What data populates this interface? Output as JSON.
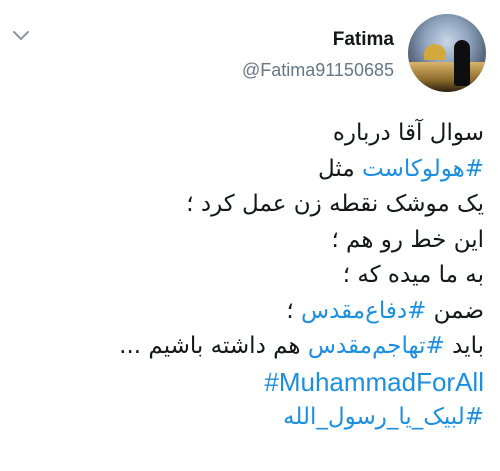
{
  "tweet": {
    "user": {
      "display_name": "Fatima",
      "handle": "@Fatima91150685"
    },
    "lines": [
      {
        "text": "سوال آقا درباره"
      },
      {
        "hashtag": "#هولوکاست",
        "after": " مثل"
      },
      {
        "text": "یک موشک نقطه زن عمل کرد ؛"
      },
      {
        "text": "این خط رو هم ؛"
      },
      {
        "text": " به ما میده که ؛"
      },
      {
        "before": "ضمن ",
        "hashtag": "#دفاع‌مقدس",
        "after": " ؛"
      },
      {
        "before": "باید ",
        "hashtag": "#تهاجم‌مقدس",
        "after": " هم داشته باشیم ..."
      }
    ],
    "hashtag_latin": "#MuhammadForAll",
    "hashtag_last": "#لبیک_یا_رسول_الله",
    "colors": {
      "hashtag": "#1d8fe0",
      "text": "#14171a",
      "handle": "#657786"
    }
  }
}
